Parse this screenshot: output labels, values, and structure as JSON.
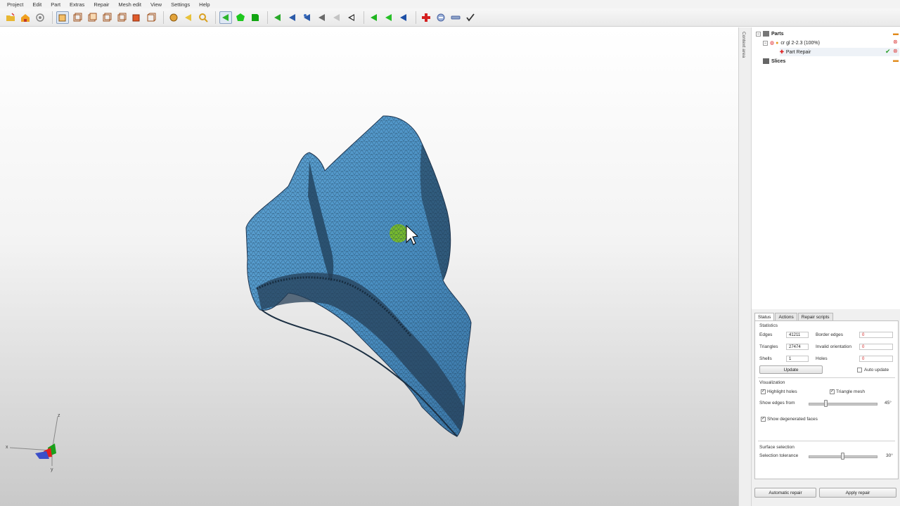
{
  "menu": [
    "Project",
    "Edit",
    "Part",
    "Extras",
    "Repair",
    "Mesh edit",
    "View",
    "Settings",
    "Help"
  ],
  "toolbar": {
    "icons": [
      "open-project-icon",
      "save-icon",
      "print-icon",
      "view-front-icon",
      "view-back-icon",
      "view-left-icon",
      "view-right-icon",
      "view-top-icon",
      "view-bottom-icon",
      "view-iso-icon",
      "shading-icon",
      "select-icon",
      "zoom-icon",
      "triangle-select-icon",
      "triangle-green-icon",
      "triangle-dark-green-icon",
      "triangle-mark-icon",
      "triangle-blue-icon",
      "triangle-blue-dot-icon",
      "triangle-gray-icon",
      "triangle-dark-icon",
      "triangle-green2-icon",
      "triangle-green3-icon",
      "triangle-blue2-icon",
      "add-repair-icon",
      "part-repair-icon",
      "measure-icon",
      "apply-icon"
    ]
  },
  "context_area": {
    "label": "Context area"
  },
  "tree": {
    "parts_label": "Parts",
    "part_name": "cr gl 2-2.3 (100%)",
    "repair_label": "Part Repair",
    "slices_label": "Slices"
  },
  "panel": {
    "tabs": [
      "Status",
      "Actions",
      "Repair scripts"
    ],
    "statistics": {
      "section": "Statistics",
      "edges_label": "Edges",
      "edges_value": "41211",
      "triangles_label": "Triangles",
      "triangles_value": "27474",
      "shells_label": "Shells",
      "shells_value": "1",
      "border_edges_label": "Border edges",
      "border_edges_value": "0",
      "invalid_orientation_label": "Invalid orientation",
      "invalid_orientation_value": "0",
      "holes_label": "Holes",
      "holes_value": "0",
      "update_label": "Update",
      "auto_update_label": "Auto update"
    },
    "visualization": {
      "section": "Visualization",
      "highlight_holes_label": "Highlight holes",
      "triangle_mesh_label": "Triangle mesh",
      "show_edges_label": "Show edges from",
      "show_edges_value": "45°",
      "show_degenerated_label": "Show degenerated faces"
    },
    "surface": {
      "section": "Surface selection",
      "tolerance_label": "Selection tolerance",
      "tolerance_value": "30°"
    },
    "automatic_repair_label": "Automatic repair",
    "apply_repair_label": "Apply repair"
  },
  "axes": {
    "x": "x",
    "y": "y",
    "z": "z"
  },
  "colors": {
    "mesh": "#4a8fc2",
    "mesh_dark": "#2b4e6b",
    "selection": "#7cbf1e"
  }
}
